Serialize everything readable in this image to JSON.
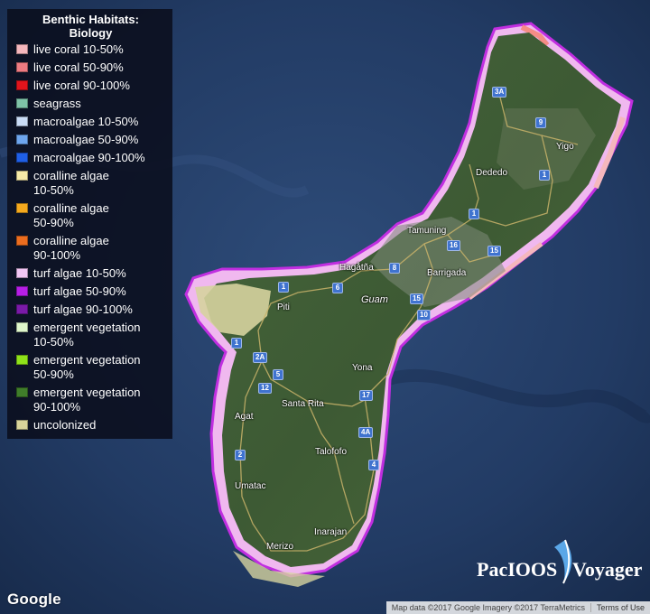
{
  "legend": {
    "title_line1": "Benthic Habitats:",
    "title_line2": "Biology",
    "items": [
      {
        "label": "live coral 10-50%",
        "color": "#f5b7bd"
      },
      {
        "label": "live coral 50-90%",
        "color": "#ee7b82"
      },
      {
        "label": "live coral 90-100%",
        "color": "#e0141c"
      },
      {
        "label": "seagrass",
        "color": "#7fc3a8"
      },
      {
        "label": "macroalgae 10-50%",
        "color": "#c9dcf6"
      },
      {
        "label": "macroalgae 50-90%",
        "color": "#6ea6ee"
      },
      {
        "label": "macroalgae 90-100%",
        "color": "#1f5fe6"
      },
      {
        "label": "coralline algae\n10-50%",
        "color": "#f6eaa8"
      },
      {
        "label": "coralline algae\n50-90%",
        "color": "#f4a91e"
      },
      {
        "label": "coralline algae\n90-100%",
        "color": "#ec6d1f"
      },
      {
        "label": "turf algae 10-50%",
        "color": "#f2c6f5"
      },
      {
        "label": "turf algae 50-90%",
        "color": "#b61ee6"
      },
      {
        "label": "turf algae 90-100%",
        "color": "#7a1aa8"
      },
      {
        "label": "emergent vegetation\n10-50%",
        "color": "#dff7cc"
      },
      {
        "label": "emergent vegetation\n50-90%",
        "color": "#8fe21a"
      },
      {
        "label": "emergent vegetation\n90-100%",
        "color": "#3f7d2a"
      },
      {
        "label": "uncolonized",
        "color": "#d8d49a"
      }
    ]
  },
  "places": {
    "yigo": "Yigo",
    "dededo": "Dededo",
    "tamuning": "Tamuning",
    "hagatna": "Hagåtña",
    "barrigada": "Barrigada",
    "guam": "Guam",
    "piti": "Piti",
    "yona": "Yona",
    "santa_rita": "Santa Rita",
    "agat": "Agat",
    "talofofo": "Talofofo",
    "umatac": "Umatac",
    "inarajan": "Inarajan",
    "merizo": "Merizo"
  },
  "shields": {
    "r3a": "3A",
    "r9": "9",
    "r1a": "1",
    "r1b": "1",
    "r16": "16",
    "r15a": "15",
    "r8": "8",
    "r1c": "1",
    "r6": "6",
    "r15b": "15",
    "r10": "10",
    "r1d": "1",
    "r2a": "2A",
    "r5": "5",
    "r12": "12",
    "r17": "17",
    "r4a": "4A",
    "r4": "4",
    "r2": "2"
  },
  "logos": {
    "google": "Google",
    "pacioos_left": "PacIOOS",
    "pacioos_right": "Voyager"
  },
  "attribution": {
    "data": "Map data ©2017 Google Imagery ©2017 TerraMetrics",
    "terms": "Terms of Use"
  },
  "colors": {
    "ocean": "#1f3559",
    "land": "#3e5a36",
    "legend_bg": "#0a0e1c"
  }
}
